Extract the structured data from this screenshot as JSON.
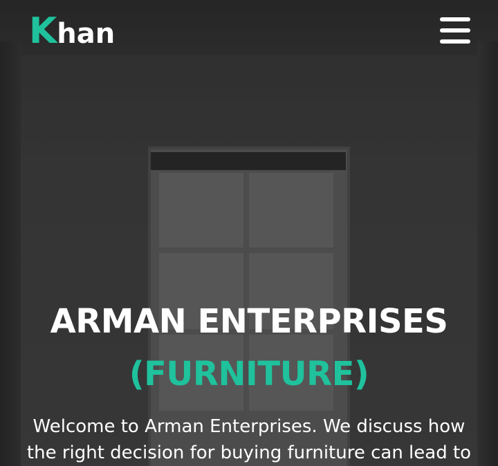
{
  "brand": {
    "logo_first_letter": "K",
    "logo_rest": "han",
    "accent_color": "#1fc29c"
  },
  "navbar": {
    "menu_icon": "hamburger-menu-icon"
  },
  "hero": {
    "title": "ARMAN ENTERPRISES",
    "subtitle": "(FURNITURE)",
    "text": "Welcome to Arman Enterprises. We discuss how the right decision for buying furniture can lead to"
  }
}
